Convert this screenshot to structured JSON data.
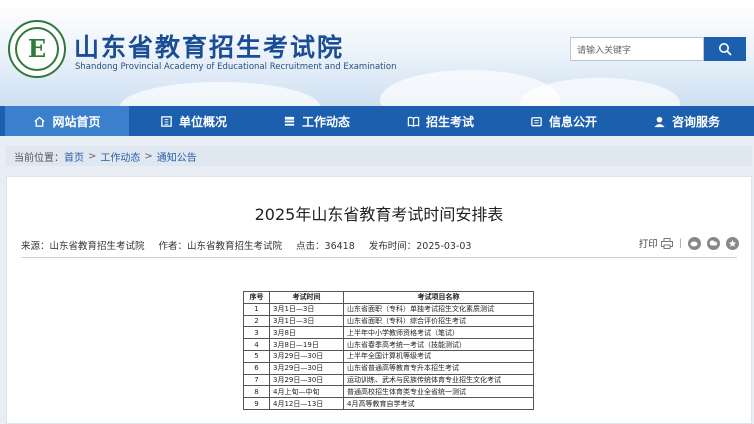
{
  "header": {
    "title": "山东省教育招生考试院",
    "subtitle": "Shandong Provincial Academy of Educational Recruitment and Examination",
    "logo_letter": "E",
    "search_placeholder": "请输入关键字"
  },
  "nav": {
    "items": [
      {
        "label": "网站首页",
        "icon": "home-icon"
      },
      {
        "label": "单位概况",
        "icon": "building-icon"
      },
      {
        "label": "工作动态",
        "icon": "list-icon"
      },
      {
        "label": "招生考试",
        "icon": "book-icon"
      },
      {
        "label": "信息公开",
        "icon": "document-icon"
      },
      {
        "label": "咨询服务",
        "icon": "user-support-icon"
      }
    ]
  },
  "breadcrumb": {
    "prefix": "当前位置：",
    "items": [
      "首页",
      "工作动态",
      "通知公告"
    ],
    "separator": ">"
  },
  "article": {
    "title": "2025年山东省教育考试时间安排表",
    "source": "来源：山东省教育招生考试院",
    "author": "作者：山东省教育招生考试院",
    "clicks": "点击：36418",
    "publish_time": "发布时间：2025-03-03",
    "print_label": "打印",
    "divider_char": "|"
  },
  "table": {
    "headers": [
      "序号",
      "考试时间",
      "考试项目名称"
    ],
    "rows": [
      [
        "1",
        "3月1日—3日",
        "山东省面职（专科）单独考试招生文化素质测试"
      ],
      [
        "2",
        "3月1日—3日",
        "山东省面职（专科）综合评价招生考试"
      ],
      [
        "3",
        "3月8日",
        "上半年中小学教师资格考试（笔试）"
      ],
      [
        "4",
        "3月8日—19日",
        "山东省春季高考统一考试（技能测试）"
      ],
      [
        "5",
        "3月29日—30日",
        "上半年全国计算机等级考试"
      ],
      [
        "6",
        "3月29日—30日",
        "山东省普通高等教育专升本招生考试"
      ],
      [
        "7",
        "3月29日—30日",
        "运动训练、武术与民族传统体育专业招生文化考试"
      ],
      [
        "8",
        "4月上旬—中旬",
        "普通高校招生体育类专业全省统一测试"
      ],
      [
        "9",
        "4月12日—13日",
        "4月高等教育自学考试"
      ]
    ]
  },
  "colors": {
    "nav_bg": "#1c5fae",
    "nav_active": "#3b80cc",
    "title_blue": "#1b4d94",
    "logo_green": "#2f7a3a"
  }
}
